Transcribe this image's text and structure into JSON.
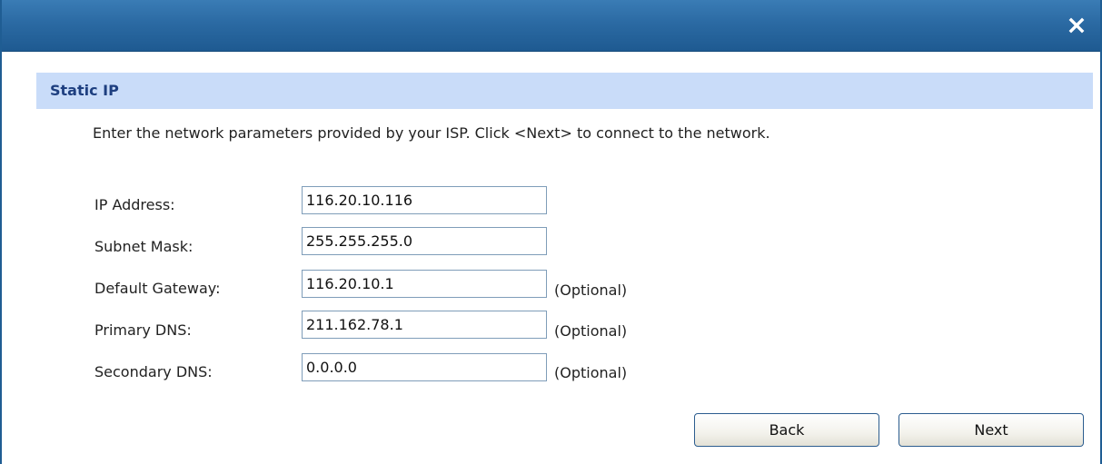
{
  "dialog": {
    "close_symbol": "✕"
  },
  "section": {
    "title": "Static IP"
  },
  "description": "Enter the network parameters provided by your ISP. Click <Next> to connect to the network.",
  "fields": [
    {
      "label": "IP Address:",
      "value": "116.20.10.116",
      "note": ""
    },
    {
      "label": "Subnet Mask:",
      "value": "255.255.255.0",
      "note": ""
    },
    {
      "label": "Default Gateway:",
      "value": "116.20.10.1",
      "note": "(Optional)"
    },
    {
      "label": "Primary DNS:",
      "value": "211.162.78.1",
      "note": "(Optional)"
    },
    {
      "label": "Secondary DNS:",
      "value": "0.0.0.0",
      "note": "(Optional)"
    }
  ],
  "buttons": {
    "back_label": "Back",
    "next_label": "Next"
  },
  "colors": {
    "titlebar": "#2b6aa3",
    "section_header_bg": "#c9dcf9",
    "section_title": "#1e3f80",
    "input_border": "#7f9db9",
    "button_border": "#2c5d8f"
  },
  "icons": {
    "close": "close-icon"
  }
}
